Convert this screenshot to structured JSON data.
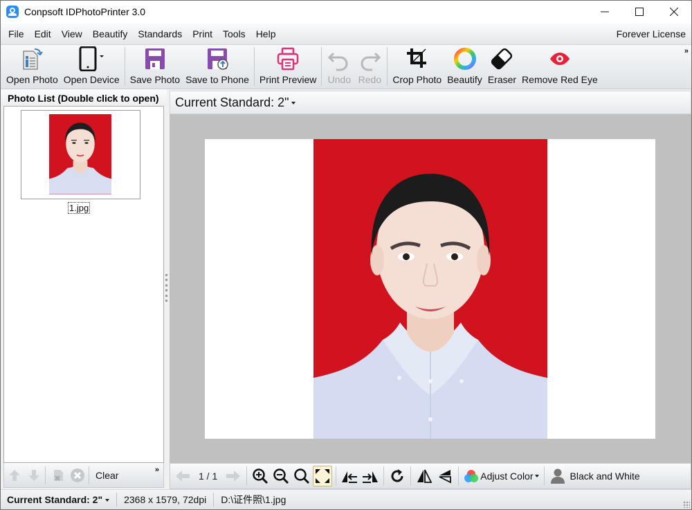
{
  "window": {
    "title": "Conpsoft IDPhotoPrinter 3.0",
    "controls": {
      "minimize": "—",
      "maximize": "☐",
      "close": "✕"
    }
  },
  "menu": {
    "items": [
      "File",
      "Edit",
      "View",
      "Beautify",
      "Standards",
      "Print",
      "Tools",
      "Help"
    ],
    "license": "Forever License"
  },
  "toolbar": {
    "buttons": [
      {
        "label": "Open Photo",
        "icon": "open-photo-icon",
        "enabled": true
      },
      {
        "label": "Open Device",
        "icon": "phone-device-icon",
        "enabled": true
      },
      {
        "label": "Save Photo",
        "icon": "floppy-disk-icon",
        "enabled": true
      },
      {
        "label": "Save to Phone",
        "icon": "floppy-upload-icon",
        "enabled": true
      },
      {
        "label": "Print Preview",
        "icon": "printer-icon",
        "enabled": true
      },
      {
        "label": "Undo",
        "icon": "undo-icon",
        "enabled": false
      },
      {
        "label": "Redo",
        "icon": "redo-icon",
        "enabled": false
      },
      {
        "label": "Crop Photo",
        "icon": "crop-icon",
        "enabled": true
      },
      {
        "label": "Beautify",
        "icon": "color-ring-icon",
        "enabled": true
      },
      {
        "label": "Eraser",
        "icon": "eraser-icon",
        "enabled": true
      },
      {
        "label": "Remove Red Eye",
        "icon": "red-eye-icon",
        "enabled": true
      }
    ],
    "overflow": "»"
  },
  "photo_list": {
    "header": "Photo List (Double click to open)",
    "items": [
      {
        "filename": "1.jpg",
        "background_color": "#d1131f"
      }
    ],
    "tools": {
      "clear_label": "Clear",
      "overflow": "»"
    }
  },
  "main": {
    "current_standard_label": "Current Standard: 2\"",
    "photo_background": "#d1131f",
    "canvas_color": "#c0c0c0",
    "pager": "1 / 1",
    "view_tools": {
      "adjust_color_label": "Adjust Color",
      "black_white_label": "Black and White"
    }
  },
  "status": {
    "standard": "Current Standard: 2\"",
    "dimensions": "2368 x 1579, 72dpi",
    "path": "D:\\证件照\\1.jpg"
  },
  "colors": {
    "accent_purple": "#8a4baf",
    "print_pink": "#e0307a",
    "red_eye": "#e8203a",
    "app_blue": "#2d8cf0"
  }
}
